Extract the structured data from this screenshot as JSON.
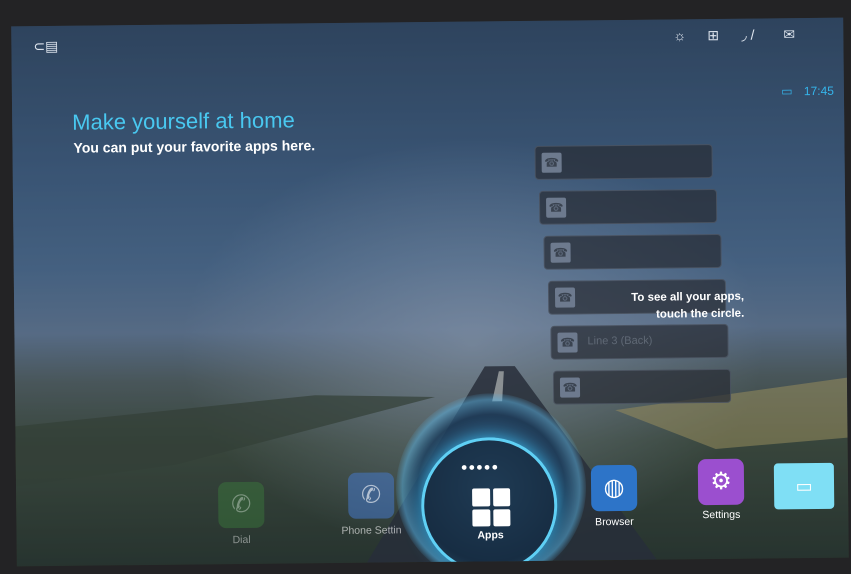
{
  "status_bar": {
    "time": "17:45",
    "icons": [
      "brightness-icon",
      "network-icon",
      "signal-icon",
      "mail-icon",
      "monitor-icon",
      "usb-icon"
    ]
  },
  "welcome": {
    "title": "Make yourself at home",
    "subtitle": "You can put your favorite apps here."
  },
  "hint": {
    "line1": "To see all your apps,",
    "line2": "touch the circle."
  },
  "favorites": {
    "ghost_text": "Line 3 (Back)"
  },
  "dock": {
    "dial_label": "Dial",
    "phone_settings_label": "Phone Settin",
    "apps_label": "Apps",
    "browser_label": "Browser",
    "settings_label": "Settings"
  },
  "colors": {
    "accent": "#49c8f0",
    "glow": "#5fd0f5",
    "settings_app": "#9b4fcf",
    "browser_app": "#2d74c8",
    "dial_app": "#3f8f3f",
    "mail_tile": "#7fdff5"
  }
}
